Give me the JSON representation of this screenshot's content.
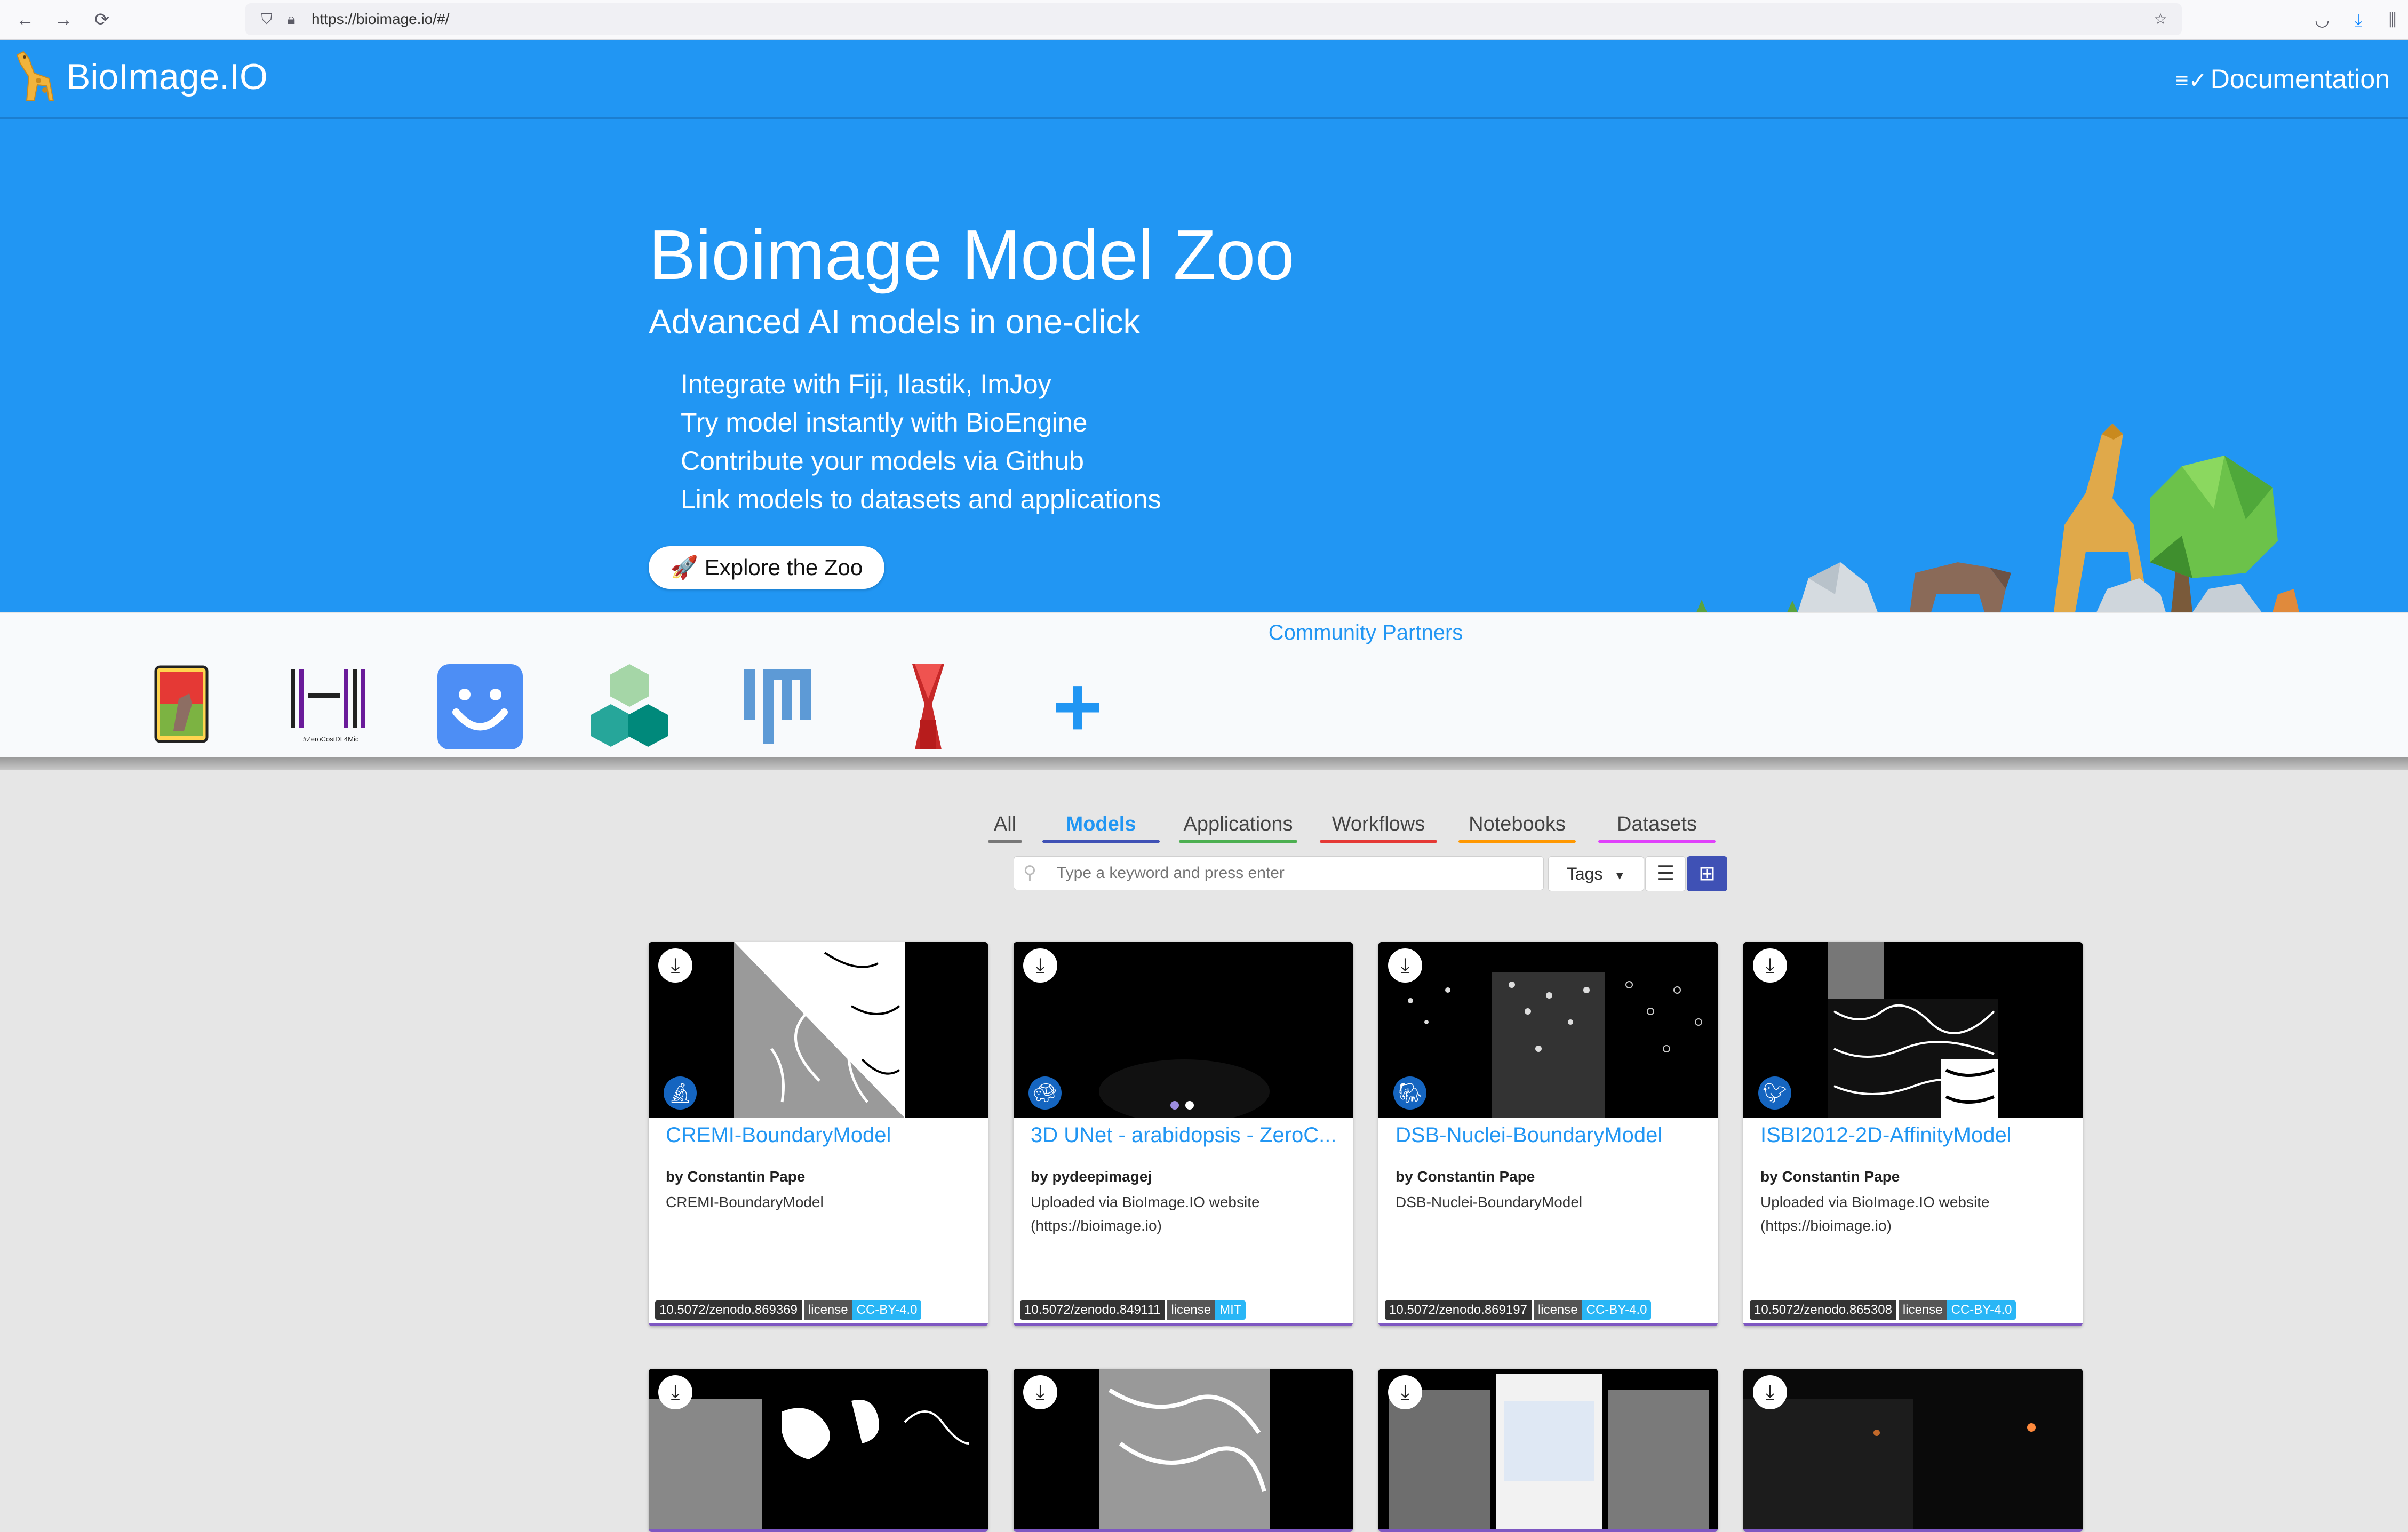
{
  "browser": {
    "url": "https://bioimage.io/#/",
    "back_icon": "arrow-left-icon",
    "forward_icon": "arrow-right-icon",
    "reload_icon": "reload-icon"
  },
  "header": {
    "logo_text": "BioImage.IO",
    "doc_label": "Documentation"
  },
  "hero": {
    "title": "Bioimage Model Zoo",
    "subtitle": "Advanced AI models in one-click",
    "bullets": [
      "Integrate with Fiji, Ilastik, ImJoy",
      "Try model instantly with BioEngine",
      "Contribute your models via Github",
      "Link models to datasets and applications"
    ],
    "cta": "Explore the Zoo",
    "cta_icon": "🚀"
  },
  "partners": {
    "title": "Community Partners",
    "items": [
      {
        "name": "ilastik"
      },
      {
        "name": "ZeroCostDL4Mic",
        "label": "#ZeroCostDL4Mic"
      },
      {
        "name": "ImJoy"
      },
      {
        "name": "HPA"
      },
      {
        "name": "Fiji"
      },
      {
        "name": "deepImageJ"
      },
      {
        "name": "add"
      }
    ]
  },
  "tabs": [
    {
      "label": "All",
      "color": "#777777"
    },
    {
      "label": "Models",
      "color": "#3f51b5",
      "active": true
    },
    {
      "label": "Applications",
      "color": "#4caf50"
    },
    {
      "label": "Workflows",
      "color": "#e53935"
    },
    {
      "label": "Notebooks",
      "color": "#ff9800"
    },
    {
      "label": "Datasets",
      "color": "#e040fb"
    }
  ],
  "search": {
    "placeholder": "Type a keyword and press enter",
    "tags_label": "Tags"
  },
  "cards": [
    {
      "title": "CREMI-BoundaryModel",
      "author": "by Constantin Pape",
      "desc": "CREMI-BoundaryModel",
      "doi": "10.5072/zenodo.869369",
      "license_label": "license",
      "license": "CC-BY-4.0",
      "badge_icon": "microscope-icon"
    },
    {
      "title": "3D UNet - arabidopsis - ZeroC...",
      "author": "by pydeepimagej",
      "desc": "Uploaded via BioImage.IO website (https://bioimage.io)",
      "doi": "10.5072/zenodo.849111",
      "license_label": "license",
      "license": "MIT",
      "badge_icon": "turtle-icon"
    },
    {
      "title": "DSB-Nuclei-BoundaryModel",
      "author": "by Constantin Pape",
      "desc": "DSB-Nuclei-BoundaryModel",
      "doi": "10.5072/zenodo.869197",
      "license_label": "license",
      "license": "CC-BY-4.0",
      "badge_icon": "elephant-icon"
    },
    {
      "title": "ISBI2012-2D-AffinityModel",
      "author": "by Constantin Pape",
      "desc": "Uploaded via BioImage.IO website (https://bioimage.io)",
      "doi": "10.5072/zenodo.865308",
      "license_label": "license",
      "license": "CC-BY-4.0",
      "badge_icon": "bird-icon"
    }
  ]
}
